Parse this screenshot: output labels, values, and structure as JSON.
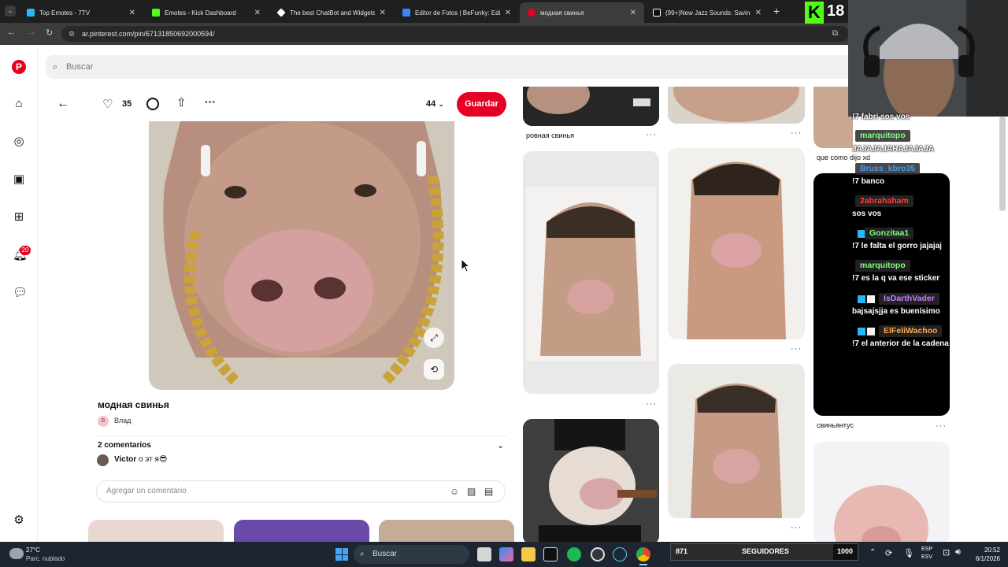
{
  "browser": {
    "tabs": [
      {
        "title": "Top Emotes - 7TV",
        "favicon_color": "#29b6f6"
      },
      {
        "title": "Emotes - Kick Dashboard",
        "favicon_color": "#53fc18"
      },
      {
        "title": "The best ChatBot and Widgets",
        "favicon_color": "#ffffff"
      },
      {
        "title": "Editor de Fotos | BeFunky: Edita",
        "favicon_color": "#4285f4"
      },
      {
        "title": "модная свинья",
        "favicon_color": "#e60023"
      },
      {
        "title": "(99+)New Jazz Sounds: Saving",
        "favicon_color": "#ffffff"
      }
    ],
    "url": "ar.pinterest.com/pin/671318506920005​94/"
  },
  "search": {
    "placeholder": "Buscar"
  },
  "rail": {
    "notification_badge": "20"
  },
  "pin": {
    "likes": "35",
    "board_count": "44",
    "save_label": "Guardar",
    "title": "модная свинья",
    "author_initial": "В",
    "author": "Влад",
    "comments_header": "2 comentarios",
    "comment_user": "Victor",
    "comment_text": "о эт я😎",
    "comment_placeholder": "Agregar un comentario"
  },
  "feed": {
    "captions": [
      "ровная свинья",
      "que como dijo xd",
      "свиньянтус"
    ]
  },
  "overlay": {
    "kick_number": "18",
    "chat": [
      {
        "user": "",
        "color": "#ffffff",
        "text": "!7 fabri sos vos"
      },
      {
        "user": "marquitopo",
        "color": "#7fff7f",
        "text": "JAJAJAJAHAJAJAJA"
      },
      {
        "user": "Bruss_kbro35",
        "color": "#3d9bff",
        "text": "!7 banco"
      },
      {
        "user": "2abrahaham",
        "color": "#ff3b3b",
        "text": "sos vos"
      },
      {
        "user": "Gonzitaa1",
        "color": "#7fff7f",
        "text": "!7 le falta el gorro jajajaj"
      },
      {
        "user": "marquitopo",
        "color": "#7fff7f",
        "text": "!7 es la q va ese sticker"
      },
      {
        "user": "IsDarthVader",
        "color": "#c77dff",
        "text": "bajsajsjja es buenísimo"
      },
      {
        "user": "ElFeliWachoo",
        "color": "#ffa64d",
        "text": "!7 el anterior de la cadena"
      }
    ],
    "followers": {
      "current": "871",
      "label": "SEGUIDORES",
      "goal": "1000",
      "progress": 0.871
    }
  },
  "taskbar": {
    "weather_temp": "27°C",
    "weather_desc": "Parc. nublado",
    "search_label": "Buscar",
    "lang_top": "ESP",
    "lang_bottom": "ESV",
    "time": "20:52",
    "date": "6/1/2026"
  }
}
